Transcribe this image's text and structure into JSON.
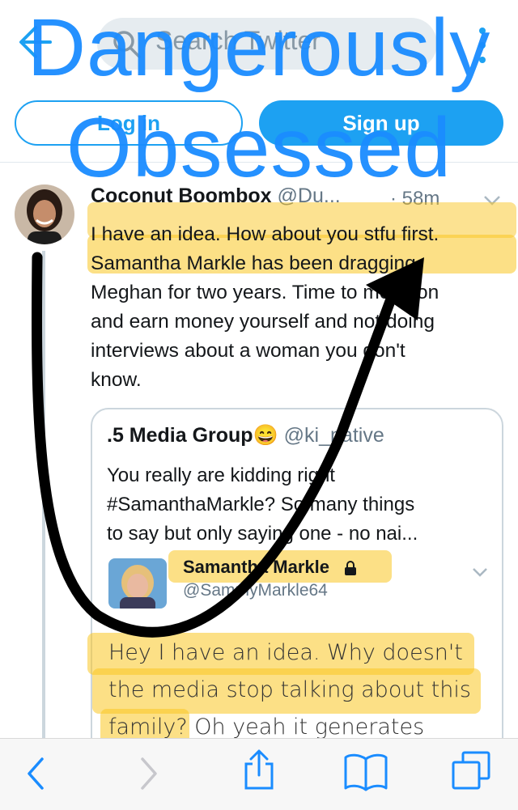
{
  "topbar": {
    "search_placeholder": "Search Twitter",
    "login_label": "Log in",
    "signup_label": "Sign up"
  },
  "tweet": {
    "author_name": "Coconut Boombox",
    "author_handle": "@Du...",
    "time": "· 58m",
    "lines": [
      "I have an idea. How about you stfu first.",
      "Samantha Markle has been dragging",
      "Meghan for two years. Time to move on",
      "and earn money yourself and not doing",
      "interviews about a woman you don't",
      "know."
    ]
  },
  "quote": {
    "name": ".5 Media Group😄",
    "handle": "@ki_native",
    "lines": [
      "You really are kidding right",
      "#SamanthaMarkle? So many things",
      "to say but only saying one - no nai..."
    ],
    "inner_name": "Samantha Markle",
    "inner_handle": "@SammyMarkle64",
    "inner_lines": [
      "Hey I have an idea. Why doesn't",
      "the media stop talking about this",
      "family? Oh yeah it generates"
    ]
  },
  "overlay": {
    "line1": "Dangerously",
    "line2": "Obsessed"
  },
  "icons": [
    "back-arrow-icon",
    "search-icon",
    "more-vertical-icon",
    "chevron-down-icon",
    "lock-icon",
    "browser-back-icon",
    "browser-forward-icon",
    "share-icon",
    "bookmarks-icon",
    "tabs-icon"
  ],
  "colors": {
    "accent": "#1da1f2",
    "overlay_text": "#1a8cff",
    "highlight": "#f9c623",
    "arrow": "#000000"
  }
}
